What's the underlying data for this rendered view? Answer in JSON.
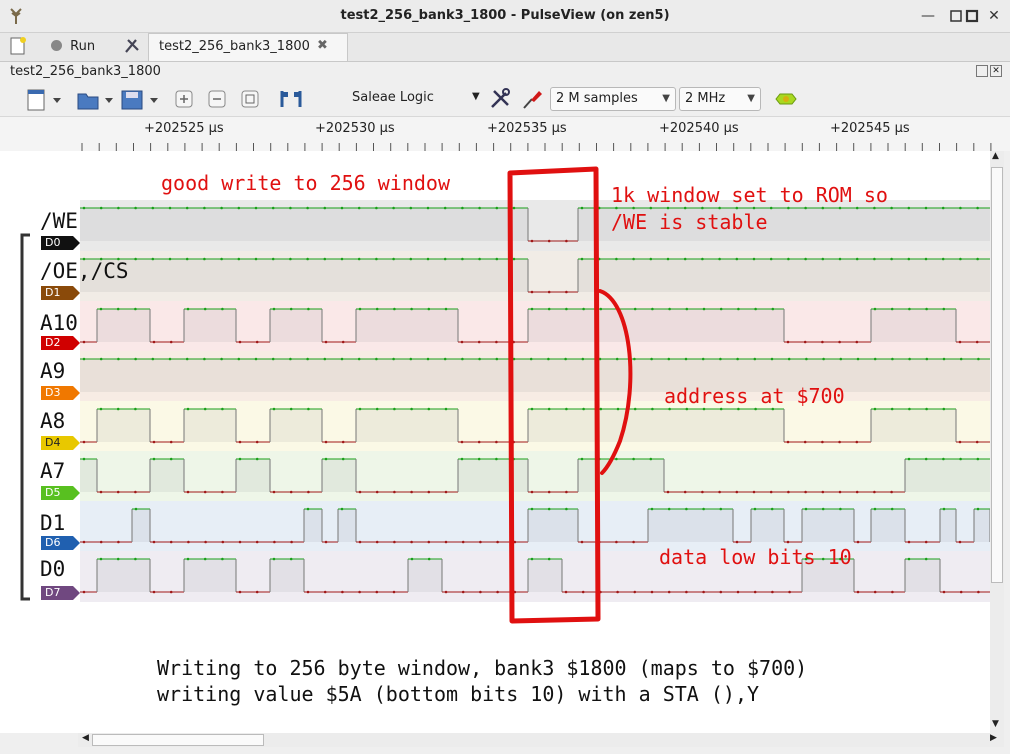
{
  "window": {
    "title": "test2_256_bank3_1800 - PulseView (on zen5)",
    "minimize": "—",
    "maximize": "□",
    "close": "✕"
  },
  "tabs": {
    "run_label": "Run",
    "doc_tab_label": "test2_256_bank3_1800",
    "doc_tab_close": "✖"
  },
  "doc_label": "test2_256_bank3_1800",
  "toolbar": {
    "device": "Saleae Logic",
    "samples": "2 M samples",
    "rate": "2 MHz"
  },
  "ruler": {
    "ticks": [
      "+202525 µs",
      "+202530 µs",
      "+202535 µs",
      "+202540 µs",
      "+202545 µs"
    ]
  },
  "channels": [
    {
      "name": "/WE",
      "tag": "D0",
      "color": "#000000"
    },
    {
      "name": "/OE,/CS",
      "tag": "D1",
      "color": "#8a4a0a"
    },
    {
      "name": "A10",
      "tag": "D2",
      "color": "#d00000"
    },
    {
      "name": "A9",
      "tag": "D3",
      "color": "#f07800"
    },
    {
      "name": "A8",
      "tag": "D4",
      "color": "#e8c800"
    },
    {
      "name": "A7",
      "tag": "D5",
      "color": "#58c020"
    },
    {
      "name": "D1",
      "tag": "D6",
      "color": "#2060b0"
    },
    {
      "name": "D0",
      "tag": "D7",
      "color": "#704880"
    }
  ],
  "annotations": {
    "good_write": "good write to 256 window",
    "rom_line1": "1k window set to ROM so",
    "rom_line2": "/WE is stable",
    "address": "address at $700",
    "data_bits": "data low bits 10",
    "note_line1": "Writing to 256 byte window, bank3 $1800 (maps to $700)",
    "note_line2": "writing value $5A (bottom bits 10) with a STA (),Y"
  },
  "colors": {
    "high": "#18a018",
    "low": "#a01818",
    "annotation": "#e01010"
  }
}
